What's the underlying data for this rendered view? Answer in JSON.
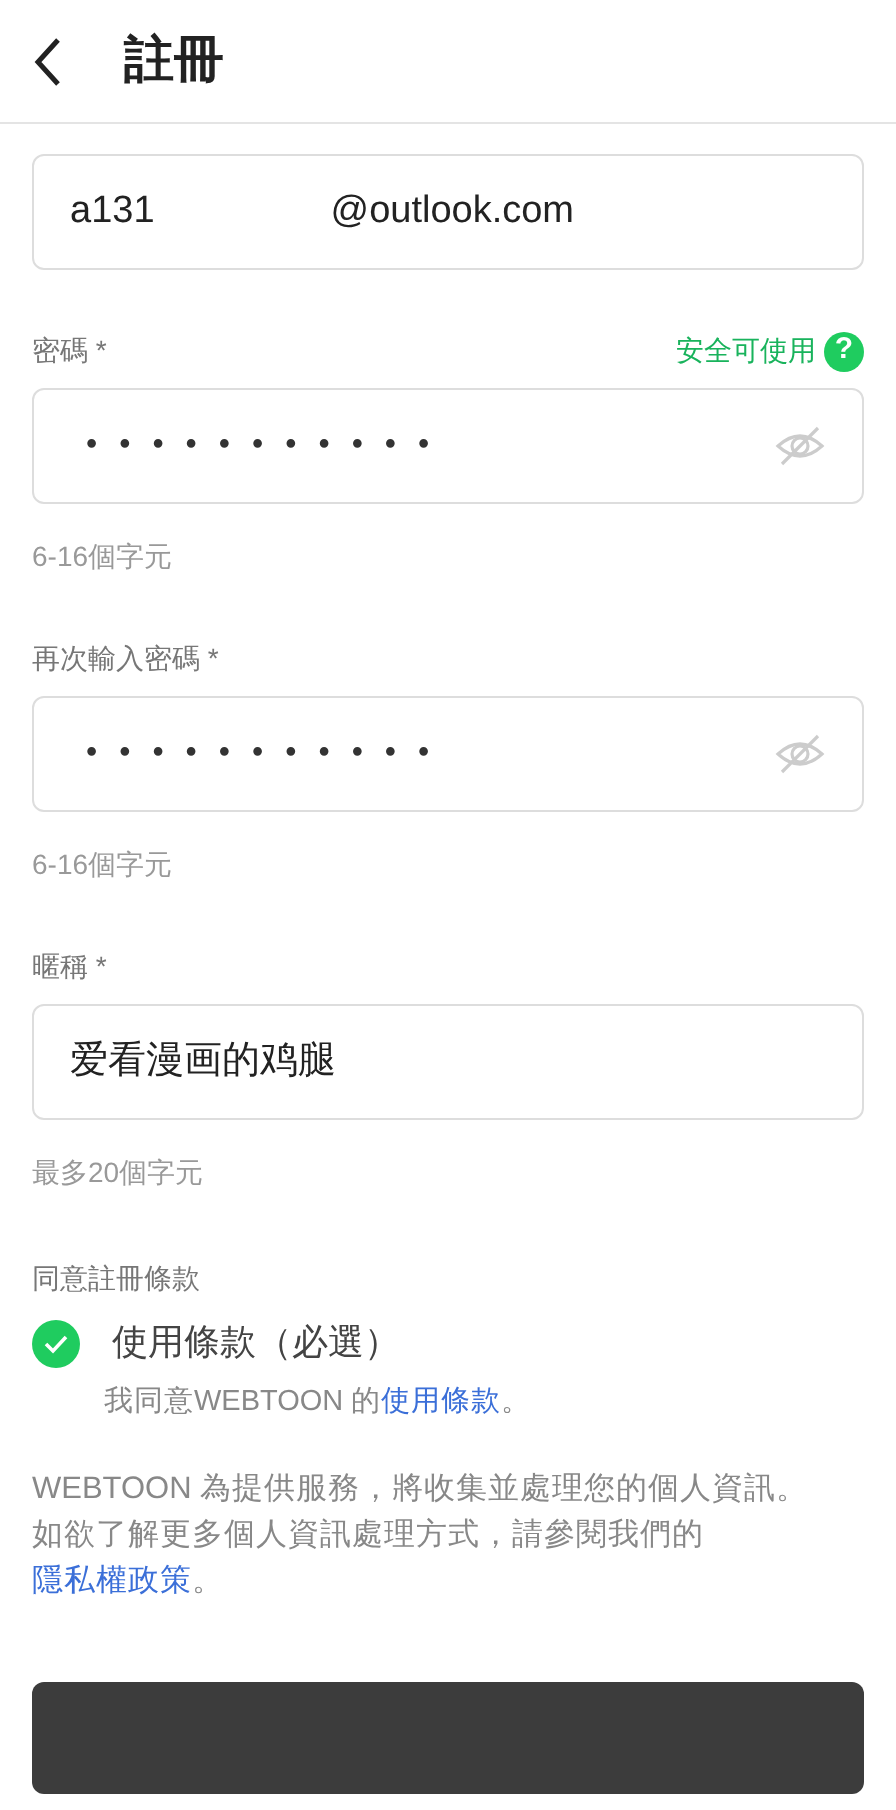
{
  "header": {
    "title": "註冊"
  },
  "email": {
    "value_start": "a131",
    "value_end": "@outlook.com"
  },
  "fields": [
    {
      "kind": "password",
      "label": "密碼 *",
      "status": "安全可使用",
      "status_help": "?",
      "value": "•••••••••••",
      "hint": "6-16個字元"
    },
    {
      "kind": "password",
      "label": "再次輸入密碼 *",
      "value": "•••••••••••",
      "hint": "6-16個字元"
    },
    {
      "kind": "text",
      "label": "暱稱 *",
      "value": "爱看漫画的鸡腿",
      "hint": "最多20個字元"
    }
  ],
  "terms": {
    "heading": "同意註冊條款",
    "items": [
      {
        "label": "使用條款（必選）",
        "checked": true,
        "desc_before": "我同意WEBTOON 的",
        "link": "使用條款",
        "desc_after": "。"
      }
    ]
  },
  "notice": {
    "text": "WEBTOON 為提供服務，將收集並處理您的個人資訊。如欲了解更多個人資訊處理方式，請參閱我們的",
    "link": "隱私權政策",
    "after": "。"
  }
}
